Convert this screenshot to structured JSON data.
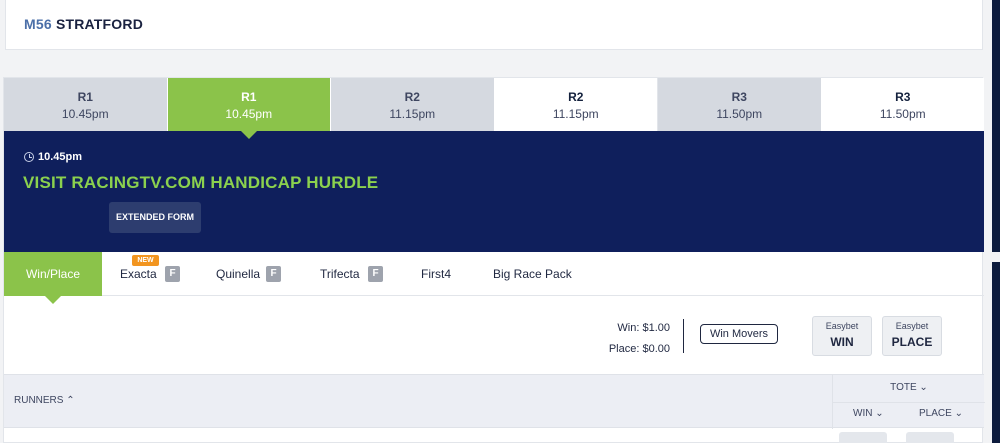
{
  "header": {
    "code": "M56",
    "venue": "STRATFORD"
  },
  "race_tabs": [
    {
      "race": "R1",
      "time": "10.45pm",
      "style": "grey"
    },
    {
      "race": "R1",
      "time": "10.45pm",
      "style": "active"
    },
    {
      "race": "R2",
      "time": "11.15pm",
      "style": "grey"
    },
    {
      "race": "R2",
      "time": "11.15pm",
      "style": "white"
    },
    {
      "race": "R3",
      "time": "11.50pm",
      "style": "grey"
    },
    {
      "race": "R3",
      "time": "11.50pm",
      "style": "white"
    }
  ],
  "race": {
    "time": "10.45pm",
    "name": "VISIT RACINGTV.COM HANDICAP HURDLE",
    "extended_form": "EXTENDED FORM"
  },
  "bet_tabs": {
    "win_place": "Win/Place",
    "exacta": "Exacta",
    "exacta_new": "NEW",
    "quinella": "Quinella",
    "trifecta": "Trifecta",
    "first4": "First4",
    "big_race_pack": "Big Race Pack",
    "f_badge": "F"
  },
  "stakes": {
    "win": "Win: $1.00",
    "place": "Place: $0.00"
  },
  "win_movers": "Win Movers",
  "easybet": {
    "win": {
      "top": "Easybet",
      "bottom": "WIN"
    },
    "place": {
      "top": "Easybet",
      "bottom": "PLACE"
    }
  },
  "runners_header": {
    "runners": "RUNNERS ⌃",
    "tote": "TOTE ⌄",
    "win": "WIN ⌄",
    "place": "PLACE ⌄"
  },
  "colors": {
    "accent_green": "#8bc34a",
    "banner_navy": "#0f1f5c",
    "race_name_green": "#8bd14e",
    "new_badge": "#f29520"
  }
}
